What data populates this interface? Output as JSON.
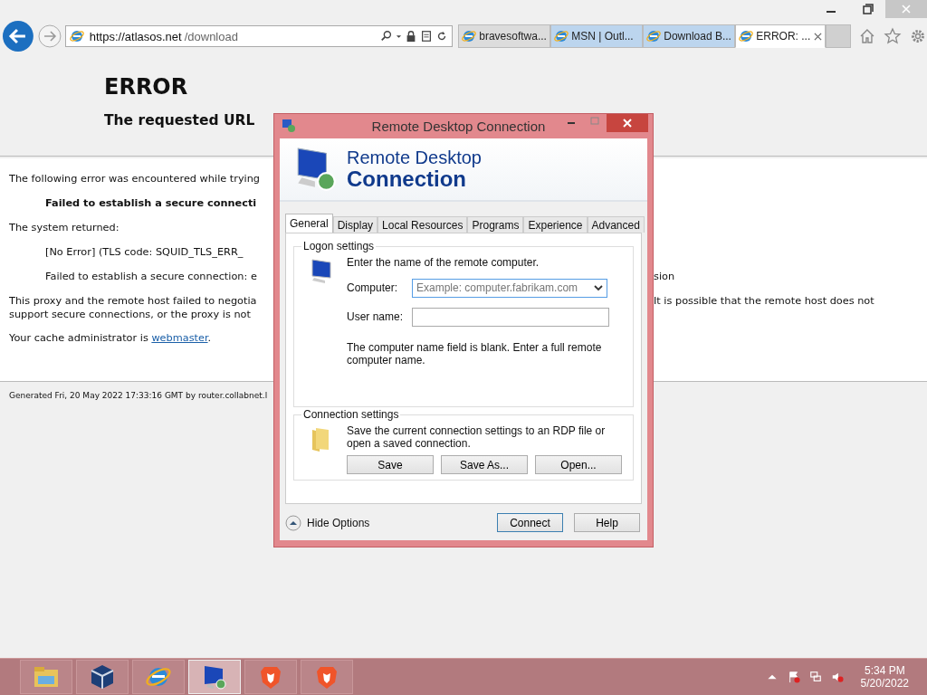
{
  "browser": {
    "address": {
      "host": "https://atlasos.net",
      "path": "/download"
    },
    "tabs": [
      {
        "title": "bravesoftwa...",
        "selected": false,
        "highlighted": false
      },
      {
        "title": "MSN | Outl...",
        "selected": false,
        "highlighted": true
      },
      {
        "title": "Download B...",
        "selected": false,
        "highlighted": true
      },
      {
        "title": "ERROR: ...",
        "selected": true,
        "highlighted": false
      }
    ]
  },
  "page": {
    "title": "ERROR",
    "subtitle": "The requested URL",
    "lines": [
      {
        "kind": "text",
        "left": "The following error was encountered while trying"
      },
      {
        "kind": "bold",
        "left": "Failed to establish a secure connecti"
      },
      {
        "kind": "text",
        "left": "The system returned:"
      },
      {
        "kind": "indent",
        "left": "[No Error] (TLS code: SQUID_TLS_ERR_"
      },
      {
        "kind": "indent",
        "left": "Failed to establish a secure connection: e",
        "right": "sion"
      },
      {
        "kind": "wrap",
        "left": "This proxy and the remote host failed to negotia",
        "right": "It is possible that the remote host does not",
        "next": "support secure connections, or the proxy is not"
      },
      {
        "kind": "link",
        "left": "Your cache administrator is ",
        "link": "webmaster",
        "after": "."
      }
    ],
    "footer": "Generated Fri, 20 May 2022 17:33:16 GMT by router.collabnet.l"
  },
  "dialog": {
    "title": "Remote Desktop Connection",
    "banner_line1": "Remote Desktop",
    "banner_line2": "Connection",
    "tabs": [
      {
        "label": "General",
        "selected": true
      },
      {
        "label": "Display",
        "selected": false
      },
      {
        "label": "Local Resources",
        "selected": false
      },
      {
        "label": "Programs",
        "selected": false
      },
      {
        "label": "Experience",
        "selected": false
      },
      {
        "label": "Advanced",
        "selected": false
      }
    ],
    "logon": {
      "legend": "Logon settings",
      "intro": "Enter the name of the remote computer.",
      "computer_label": "Computer:",
      "computer_placeholder": "Example: computer.fabrikam.com",
      "user_label": "User name:",
      "note": "The computer name field is blank. Enter a full remote computer name."
    },
    "connection": {
      "legend": "Connection settings",
      "text": "Save the current connection settings to an RDP file or open a saved connection.",
      "buttons": [
        "Save",
        "Save As...",
        "Open..."
      ]
    },
    "toggle": "Hide Options",
    "connect": "Connect",
    "help": "Help"
  },
  "taskbar": {
    "apps": [
      {
        "kind": "folder",
        "active": false
      },
      {
        "kind": "cube",
        "active": false
      },
      {
        "kind": "ie",
        "active": false
      },
      {
        "kind": "rdp",
        "active": true
      },
      {
        "kind": "brave",
        "active": false
      },
      {
        "kind": "brave",
        "active": false
      }
    ],
    "time": "5:34 PM",
    "date": "5/20/2022"
  }
}
